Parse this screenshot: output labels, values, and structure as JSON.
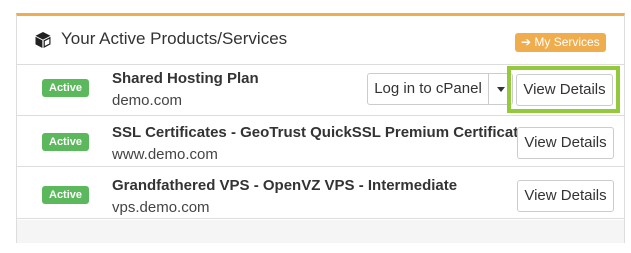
{
  "panel": {
    "title": "Your Active Products/Services",
    "title_icon": "cube-icon",
    "my_services_label": "My Services",
    "my_services_icon": "arrow-right-icon",
    "accent_color": "#f0ad4e",
    "highlight_color": "#95c93d"
  },
  "products": [
    {
      "status": "Active",
      "name": "Shared Hosting Plan",
      "domain": "demo.com",
      "cpanel_label": "Log in to cPanel",
      "view_label": "View Details"
    },
    {
      "status": "Active",
      "name": "SSL Certificates - GeoTrust QuickSSL Premium Certificate",
      "domain": "www.demo.com",
      "view_label": "View Details"
    },
    {
      "status": "Active",
      "name": "Grandfathered VPS - OpenVZ VPS - Intermediate",
      "domain": "vps.demo.com",
      "view_label": "View Details"
    }
  ],
  "colors": {
    "status_active": "#5cb85c"
  }
}
